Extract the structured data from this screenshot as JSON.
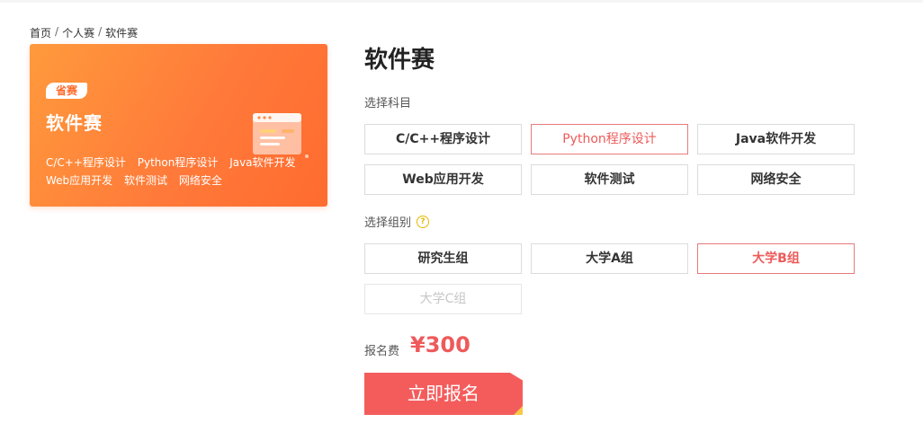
{
  "breadcrumb": [
    "首页",
    "个人赛",
    "软件赛"
  ],
  "banner": {
    "tag": "省赛",
    "title": "软件赛",
    "courses_line1": [
      "C/C++程序设计",
      "Python程序设计",
      "Java软件开发"
    ],
    "courses_line2": [
      "Web应用开发",
      "软件测试",
      "网络安全"
    ]
  },
  "page_title": "软件赛",
  "subject": {
    "label": "选择科目",
    "options": [
      "C/C++程序设计",
      "Python程序设计",
      "Java软件开发",
      "Web应用开发",
      "软件测试",
      "网络安全"
    ],
    "selected": "Python程序设计"
  },
  "group": {
    "label": "选择组别",
    "help_icon": "question-circle-icon",
    "options": [
      "研究生组",
      "大学A组",
      "大学B组",
      "大学C组"
    ],
    "selected": "大学B组",
    "disabled": "大学C组"
  },
  "fee": {
    "label": "报名费",
    "value": "¥300"
  },
  "signup_button": "立即报名",
  "colors": {
    "accent": "#f45c5c",
    "banner": "#ff7a3a",
    "selected_border": "#e77b7b",
    "corner": "#f7c948"
  }
}
